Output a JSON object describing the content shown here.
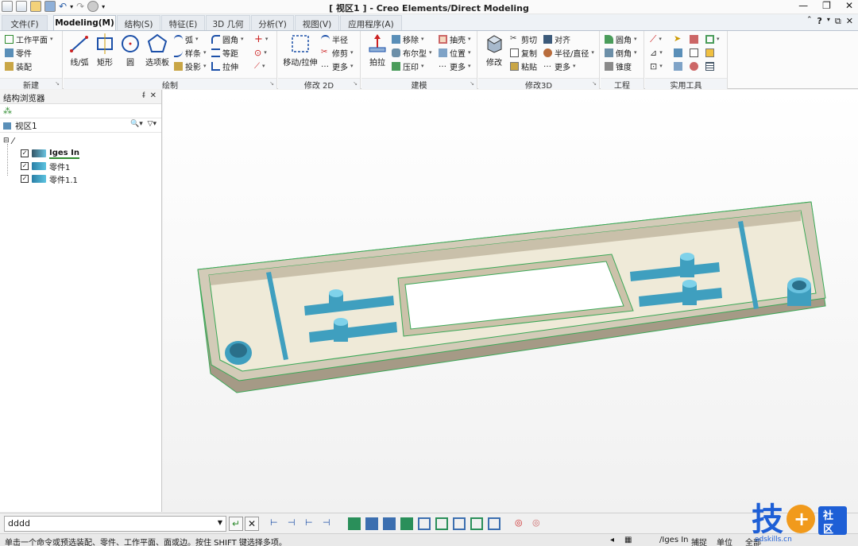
{
  "title_bar": {
    "title": "[ 视区1 ] - Creo Elements/Direct Modeling",
    "window_controls": [
      "minimize-icon",
      "restore-icon",
      "close-icon"
    ]
  },
  "tabs": [
    {
      "label": "文件(F)"
    },
    {
      "label": "Modeling(M)"
    },
    {
      "label": "结构(S)"
    },
    {
      "label": "特征(E)"
    },
    {
      "label": "3D 几何"
    },
    {
      "label": "分析(Y)"
    },
    {
      "label": "视图(V)"
    },
    {
      "label": "应用程序(A)"
    }
  ],
  "ribbon": {
    "new": {
      "label": "新建",
      "items": [
        "工作平面",
        "零件",
        "装配"
      ]
    },
    "draw": {
      "label": "绘制",
      "line": "线/弧",
      "rect": "矩形",
      "circle": "圆",
      "polygon": "选项板",
      "arc": "弧",
      "spline": "样条",
      "project": "投影",
      "fillet": "圆角",
      "offset": "等距",
      "stretch": "拉伸"
    },
    "modify2d": {
      "label": "修改 2D",
      "move": "移动/拉伸",
      "radius": "半径",
      "trim": "修剪",
      "more": "更多"
    },
    "build": {
      "label": "建模",
      "extrude": "拍拉",
      "remove": "移除",
      "boolean": "布尔型",
      "imprint": "压印",
      "shell": "抽壳",
      "position": "位置",
      "more": "更多"
    },
    "modify3d": {
      "label": "修改3D",
      "modify": "修改",
      "cut": "剪切",
      "copy": "复制",
      "paste": "粘贴",
      "align": "对齐",
      "radius_dia": "半径/直径",
      "more": "更多"
    },
    "engineering": {
      "label": "工程",
      "fillet": "圆角",
      "chamfer": "倒角",
      "draft": "锥度"
    },
    "utilities": {
      "label": "实用工具"
    }
  },
  "browser": {
    "title": "结构浏览器",
    "viewport": "视区1",
    "tree": [
      {
        "label": "Iges In",
        "checked": true,
        "bold": true
      },
      {
        "label": "零件1",
        "checked": true
      },
      {
        "label": "零件1.1",
        "checked": true
      }
    ]
  },
  "command": {
    "value": "dddd"
  },
  "status": {
    "message": "单击一个命令或预选装配、零件、工作平面、面或边。按住 SHIFT 键选择多项。",
    "path": "/Iges In",
    "snap": "捕捉",
    "units": "单位",
    "all": "全部"
  },
  "watermark": {
    "char": "技",
    "side": "社区",
    "site": "adskills.cn"
  }
}
